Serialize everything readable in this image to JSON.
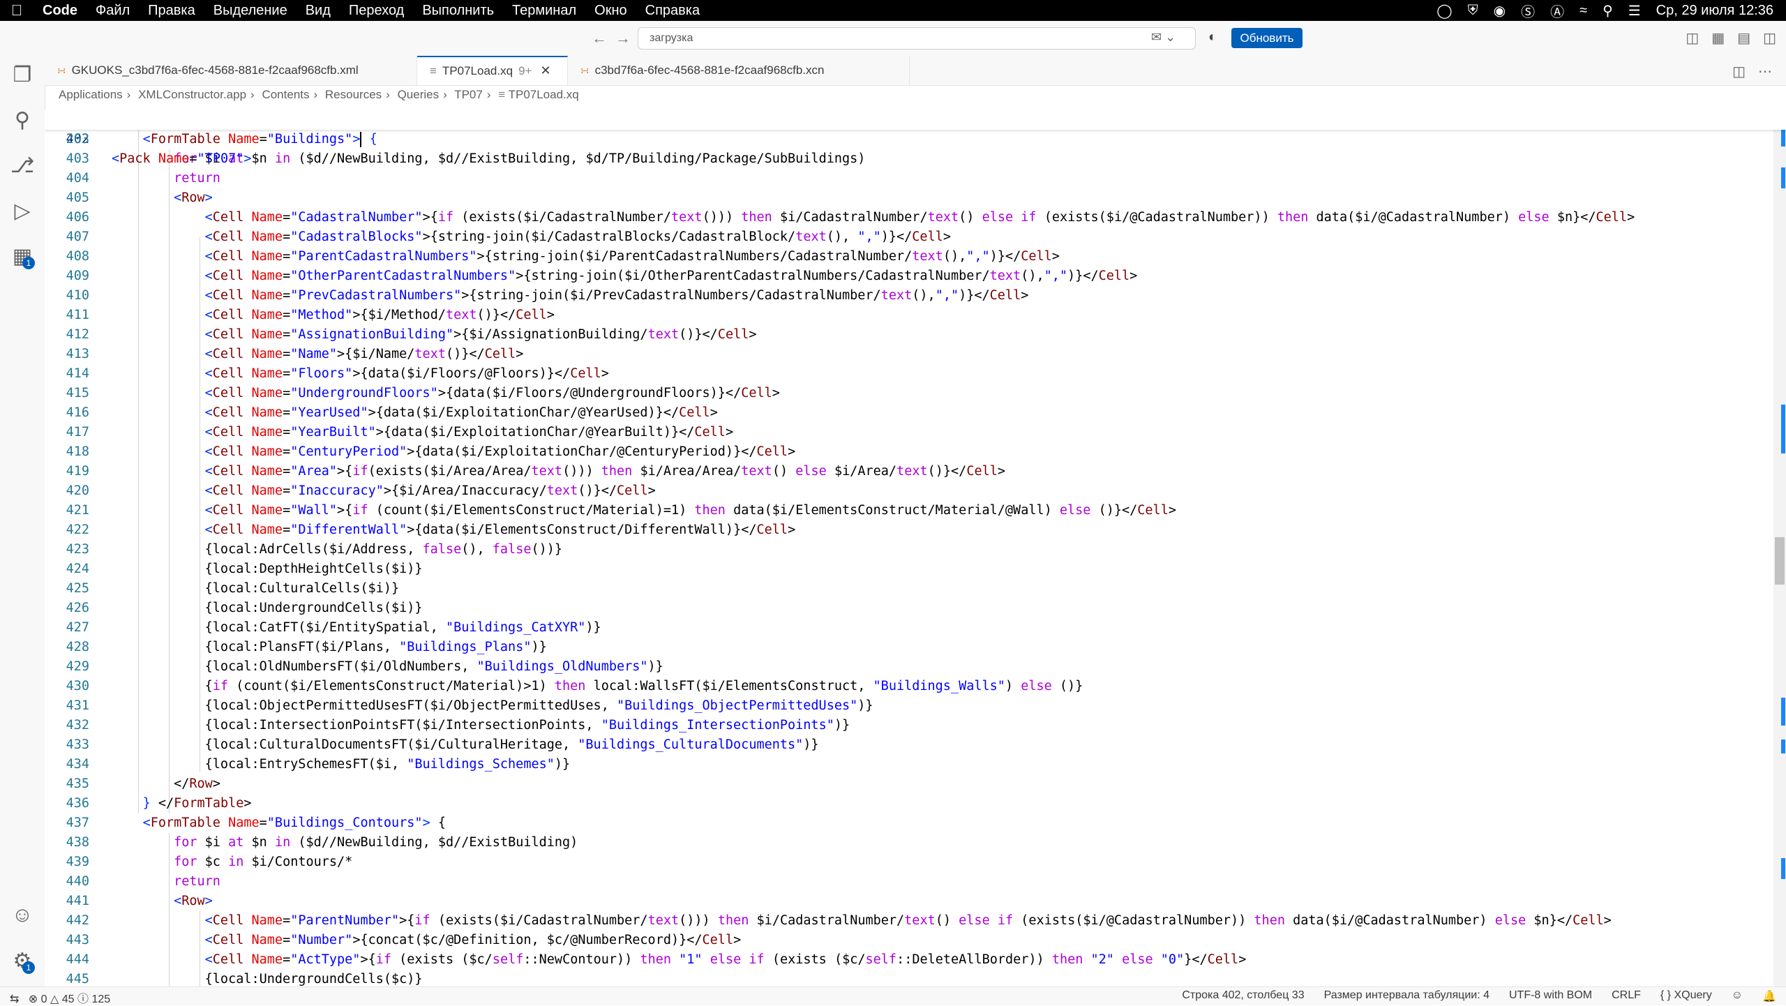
{
  "menubar": {
    "app_name": "Code",
    "items": [
      "Файл",
      "Правка",
      "Выделение",
      "Вид",
      "Переход",
      "Выполнить",
      "Терминал",
      "Окно",
      "Справка"
    ],
    "datetime": "Ср, 29 июля  12:36"
  },
  "titlebar": {
    "command_center_text": "загрузка",
    "update_button": "Обновить"
  },
  "activity_bar": {
    "extensions_badge": "1",
    "settings_badge": "1"
  },
  "tabs": [
    {
      "label": "GKUOKS_c3bd7f6a-6fec-4568-881e-f2caaf968cfb.xml",
      "active": false
    },
    {
      "label": "TP07Load.xq",
      "modified": "9+",
      "active": true
    },
    {
      "label": "c3bd7f6a-6fec-4568-881e-f2caaf968cfb.xcn",
      "active": false
    }
  ],
  "breadcrumb": [
    "Applications",
    "XMLConstructor.app",
    "Contents",
    "Resources",
    "Queries",
    "TP07",
    "TP07Load.xq"
  ],
  "editor": {
    "sticky_line": {
      "num": "263",
      "html": "<span class='bracket'>&lt;</span><span class='tag'>Pack</span> <span class='attr'>Name</span>=<span class='str'>\"TP07\"</span><span class='bracket'>&gt;</span>"
    },
    "lines": [
      {
        "num": "402",
        "html": "    <span class='bracket'>&lt;</span><span class='tag'>FormTable</span> <span class='attr'>Name</span>=<span class='str'>\"Buildings\"</span><span class='bracket'>&gt;</span><span class='cursor'></span> <span class='bracket'>{</span>"
      },
      {
        "num": "403",
        "html": "        <span class='kw'>for</span> $i <span class='kw'>at</span> $n <span class='kw'>in</span> ($d//NewBuilding, $d//ExistBuilding, $d/TP/Building/Package/SubBuildings)"
      },
      {
        "num": "404",
        "html": "        <span class='kw'>return</span>"
      },
      {
        "num": "405",
        "html": "        <span class='bracket'>&lt;</span><span class='tag'>Row</span><span class='bracket'>&gt;</span>"
      },
      {
        "num": "406",
        "html": "            <span class='bracket'>&lt;</span><span class='tag'>Cell</span> <span class='attr'>Name</span>=<span class='str'>\"CadastralNumber\"</span>&gt;{<span class='kw'>if</span> (exists($i/CadastralNumber/<span class='kw'>text</span>())) <span class='kw'>then</span> $i/CadastralNumber/<span class='kw'>text</span>() <span class='kw'>else</span> <span class='kw'>if</span> (exists($i/@CadastralNumber)) <span class='kw'>then</span> data($i/@CadastralNumber) <span class='kw'>else</span> $n}&lt;/<span class='tag'>Cell</span>&gt;"
      },
      {
        "num": "407",
        "html": "            <span class='bracket'>&lt;</span><span class='tag'>Cell</span> <span class='attr'>Name</span>=<span class='str'>\"CadastralBlocks\"</span>&gt;{string-join($i/CadastralBlocks/CadastralBlock/<span class='kw'>text</span>(), <span class='str'>\",\"</span>)}&lt;/<span class='tag'>Cell</span>&gt;"
      },
      {
        "num": "408",
        "html": "            <span class='bracket'>&lt;</span><span class='tag'>Cell</span> <span class='attr'>Name</span>=<span class='str'>\"ParentCadastralNumbers\"</span>&gt;{string-join($i/ParentCadastralNumbers/CadastralNumber/<span class='kw'>text</span>(),<span class='str'>\",\"</span>)}&lt;/<span class='tag'>Cell</span>&gt;"
      },
      {
        "num": "409",
        "html": "            <span class='bracket'>&lt;</span><span class='tag'>Cell</span> <span class='attr'>Name</span>=<span class='str'>\"OtherParentCadastralNumbers\"</span>&gt;{string-join($i/OtherParentCadastralNumbers/CadastralNumber/<span class='kw'>text</span>(),<span class='str'>\",\"</span>)}&lt;/<span class='tag'>Cell</span>&gt;"
      },
      {
        "num": "410",
        "html": "            <span class='bracket'>&lt;</span><span class='tag'>Cell</span> <span class='attr'>Name</span>=<span class='str'>\"PrevCadastralNumbers\"</span>&gt;{string-join($i/PrevCadastralNumbers/CadastralNumber/<span class='kw'>text</span>(),<span class='str'>\",\"</span>)}&lt;/<span class='tag'>Cell</span>&gt;"
      },
      {
        "num": "411",
        "html": "            <span class='bracket'>&lt;</span><span class='tag'>Cell</span> <span class='attr'>Name</span>=<span class='str'>\"Method\"</span>&gt;{$i/Method/<span class='kw'>text</span>()}&lt;/<span class='tag'>Cell</span>&gt;"
      },
      {
        "num": "412",
        "html": "            <span class='bracket'>&lt;</span><span class='tag'>Cell</span> <span class='attr'>Name</span>=<span class='str'>\"AssignationBuilding\"</span>&gt;{$i/AssignationBuilding/<span class='kw'>text</span>()}&lt;/<span class='tag'>Cell</span>&gt;"
      },
      {
        "num": "413",
        "html": "            <span class='bracket'>&lt;</span><span class='tag'>Cell</span> <span class='attr'>Name</span>=<span class='str'>\"Name\"</span>&gt;{$i/Name/<span class='kw'>text</span>()}&lt;/<span class='tag'>Cell</span>&gt;"
      },
      {
        "num": "414",
        "html": "            <span class='bracket'>&lt;</span><span class='tag'>Cell</span> <span class='attr'>Name</span>=<span class='str'>\"Floors\"</span>&gt;{data($i/Floors/@Floors)}&lt;/<span class='tag'>Cell</span>&gt;"
      },
      {
        "num": "415",
        "html": "            <span class='bracket'>&lt;</span><span class='tag'>Cell</span> <span class='attr'>Name</span>=<span class='str'>\"UndergroundFloors\"</span>&gt;{data($i/Floors/@UndergroundFloors)}&lt;/<span class='tag'>Cell</span>&gt;"
      },
      {
        "num": "416",
        "html": "            <span class='bracket'>&lt;</span><span class='tag'>Cell</span> <span class='attr'>Name</span>=<span class='str'>\"YearUsed\"</span>&gt;{data($i/ExploitationChar/@YearUsed)}&lt;/<span class='tag'>Cell</span>&gt;"
      },
      {
        "num": "417",
        "html": "            <span class='bracket'>&lt;</span><span class='tag'>Cell</span> <span class='attr'>Name</span>=<span class='str'>\"YearBuilt\"</span>&gt;{data($i/ExploitationChar/@YearBuilt)}&lt;/<span class='tag'>Cell</span>&gt;"
      },
      {
        "num": "418",
        "html": "            <span class='bracket'>&lt;</span><span class='tag'>Cell</span> <span class='attr'>Name</span>=<span class='str'>\"CenturyPeriod\"</span>&gt;{data($i/ExploitationChar/@CenturyPeriod)}&lt;/<span class='tag'>Cell</span>&gt;"
      },
      {
        "num": "419",
        "html": "            <span class='bracket'>&lt;</span><span class='tag'>Cell</span> <span class='attr'>Name</span>=<span class='str'>\"Area\"</span>&gt;{<span class='kw'>if</span>(exists($i/Area/Area/<span class='kw'>text</span>())) <span class='kw'>then</span> $i/Area/Area/<span class='kw'>text</span>() <span class='kw'>else</span> $i/Area/<span class='kw'>text</span>()}&lt;/<span class='tag'>Cell</span>&gt;"
      },
      {
        "num": "420",
        "html": "            <span class='bracket'>&lt;</span><span class='tag'>Cell</span> <span class='attr'>Name</span>=<span class='str'>\"Inaccuracy\"</span>&gt;{$i/Area/Inaccuracy/<span class='kw'>text</span>()}&lt;/<span class='tag'>Cell</span>&gt;"
      },
      {
        "num": "421",
        "html": "            <span class='bracket'>&lt;</span><span class='tag'>Cell</span> <span class='attr'>Name</span>=<span class='str'>\"Wall\"</span>&gt;{<span class='kw'>if</span> (count($i/ElementsConstruct/Material)=1) <span class='kw'>then</span> data($i/ElementsConstruct/Material/@Wall) <span class='kw'>else</span> ()}&lt;/<span class='tag'>Cell</span>&gt;"
      },
      {
        "num": "422",
        "html": "            <span class='bracket'>&lt;</span><span class='tag'>Cell</span> <span class='attr'>Name</span>=<span class='str'>\"DifferentWall\"</span>&gt;{data($i/ElementsConstruct/DifferentWall)}&lt;/<span class='tag'>Cell</span>&gt;"
      },
      {
        "num": "423",
        "html": "            {local:AdrCells($i/Address, <span class='kw'>false</span>(), <span class='kw'>false</span>())}"
      },
      {
        "num": "424",
        "html": "            {local:DepthHeightCells($i)}"
      },
      {
        "num": "425",
        "html": "            {local:CulturalCells($i)}"
      },
      {
        "num": "426",
        "html": "            {local:UndergroundCells($i)}"
      },
      {
        "num": "427",
        "html": "            {local:CatFT($i/EntitySpatial, <span class='str'>\"Buildings_CatXYR\"</span>)}"
      },
      {
        "num": "428",
        "html": "            {local:PlansFT($i/Plans, <span class='str'>\"Buildings_Plans\"</span>)}"
      },
      {
        "num": "429",
        "html": "            {local:OldNumbersFT($i/OldNumbers, <span class='str'>\"Buildings_OldNumbers\"</span>)}"
      },
      {
        "num": "430",
        "html": "            {<span class='kw'>if</span> (count($i/ElementsConstruct/Material)&gt;1) <span class='kw'>then</span> local:WallsFT($i/ElementsConstruct, <span class='str'>\"Buildings_Walls\"</span>) <span class='kw'>else</span> ()}"
      },
      {
        "num": "431",
        "html": "            {local:ObjectPermittedUsesFT($i/ObjectPermittedUses, <span class='str'>\"Buildings_ObjectPermittedUses\"</span>)}"
      },
      {
        "num": "432",
        "html": "            {local:IntersectionPointsFT($i/IntersectionPoints, <span class='str'>\"Buildings_IntersectionPoints\"</span>)}"
      },
      {
        "num": "433",
        "html": "            {local:CulturalDocumentsFT($i/CulturalHeritage, <span class='str'>\"Buildings_CulturalDocuments\"</span>)}"
      },
      {
        "num": "434",
        "html": "            {local:EntrySchemesFT($i, <span class='str'>\"Buildings_Schemes\"</span>)}"
      },
      {
        "num": "435",
        "html": "        &lt;/<span class='tag'>Row</span>&gt;"
      },
      {
        "num": "436",
        "html": "    <span class='bracket'>}</span> &lt;/<span class='tag'>FormTable</span>&gt;"
      },
      {
        "num": "437",
        "html": "    <span class='bracket'>&lt;</span><span class='tag'>FormTable</span> <span class='attr'>Name</span>=<span class='str'>\"Buildings_Contours\"</span><span class='bracket'>&gt;</span> {"
      },
      {
        "num": "438",
        "html": "        <span class='kw'>for</span> $i <span class='kw'>at</span> $n <span class='kw'>in</span> ($d//NewBuilding, $d//ExistBuilding)"
      },
      {
        "num": "439",
        "html": "        <span class='kw'>for</span> $c <span class='kw'>in</span> $i/Contours/*"
      },
      {
        "num": "440",
        "html": "        <span class='kw'>return</span>"
      },
      {
        "num": "441",
        "html": "        <span class='bracket'>&lt;</span><span class='tag'>Row</span><span class='bracket'>&gt;</span>"
      },
      {
        "num": "442",
        "html": "            <span class='bracket'>&lt;</span><span class='tag'>Cell</span> <span class='attr'>Name</span>=<span class='str'>\"ParentNumber\"</span>&gt;{<span class='kw'>if</span> (exists($i/CadastralNumber/<span class='kw'>text</span>())) <span class='kw'>then</span> $i/CadastralNumber/<span class='kw'>text</span>() <span class='kw'>else</span> <span class='kw'>if</span> (exists($i/@CadastralNumber)) <span class='kw'>then</span> data($i/@CadastralNumber) <span class='kw'>else</span> $n}&lt;/<span class='tag'>Cell</span>&gt;"
      },
      {
        "num": "443",
        "html": "            <span class='bracket'>&lt;</span><span class='tag'>Cell</span> <span class='attr'>Name</span>=<span class='str'>\"Number\"</span>&gt;{concat($c/@Definition, $c/@NumberRecord)}&lt;/<span class='tag'>Cell</span>&gt;"
      },
      {
        "num": "444",
        "html": "            <span class='bracket'>&lt;</span><span class='tag'>Cell</span> <span class='attr'>Name</span>=<span class='str'>\"ActType\"</span>&gt;{<span class='kw'>if</span> (exists ($c/<span class='kw'>self</span>::NewContour)) <span class='kw'>then</span> <span class='str'>\"1\"</span> <span class='kw'>else</span> <span class='kw'>if</span> (exists ($c/<span class='kw'>self</span>::DeleteAllBorder)) <span class='kw'>then</span> <span class='str'>\"2\"</span> <span class='kw'>else</span> <span class='str'>\"0\"</span>}&lt;/<span class='tag'>Cell</span>&gt;"
      },
      {
        "num": "445",
        "html": "            {local:UndergroundCells($c)}"
      }
    ]
  },
  "statusbar": {
    "errors": "0",
    "warnings": "45",
    "info": "125",
    "position": "Строка 402, столбец 33",
    "tab_size": "Размер интервала табуляции: 4",
    "encoding": "UTF-8 with BOM",
    "eol": "CRLF",
    "language": "XQuery"
  },
  "colors": {
    "accent": "#005fb8",
    "tag": "#800000",
    "attr": "#e50000",
    "string": "#0000ff",
    "keyword": "#af00db"
  }
}
